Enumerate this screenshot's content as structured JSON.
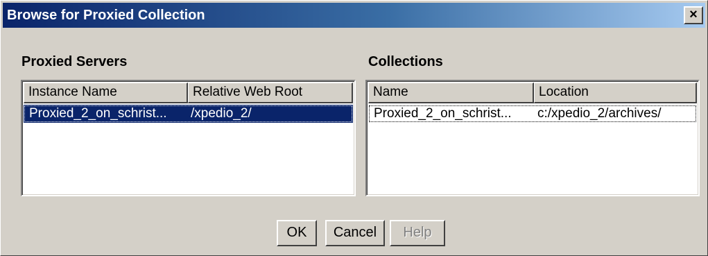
{
  "window": {
    "title": "Browse for Proxied Collection",
    "close_label": "×"
  },
  "proxied_servers": {
    "heading": "Proxied Servers",
    "columns": [
      "Instance Name",
      "Relative Web Root"
    ],
    "rows": [
      [
        "Proxied_2_on_schrist...",
        "/xpedio_2/"
      ]
    ],
    "selected_row": 0
  },
  "collections": {
    "heading": "Collections",
    "columns": [
      "Name",
      "Location"
    ],
    "rows": [
      [
        "Proxied_2_on_schrist...",
        "c:/xpedio_2/archives/"
      ]
    ],
    "focused_row": 0
  },
  "buttons": {
    "ok": "OK",
    "cancel": "Cancel",
    "help": "Help",
    "help_enabled": false
  },
  "colors": {
    "title_gradient_start": "#0a246a",
    "title_gradient_end": "#a6caf0",
    "selection": "#0a246a",
    "face": "#d4d0c8"
  }
}
